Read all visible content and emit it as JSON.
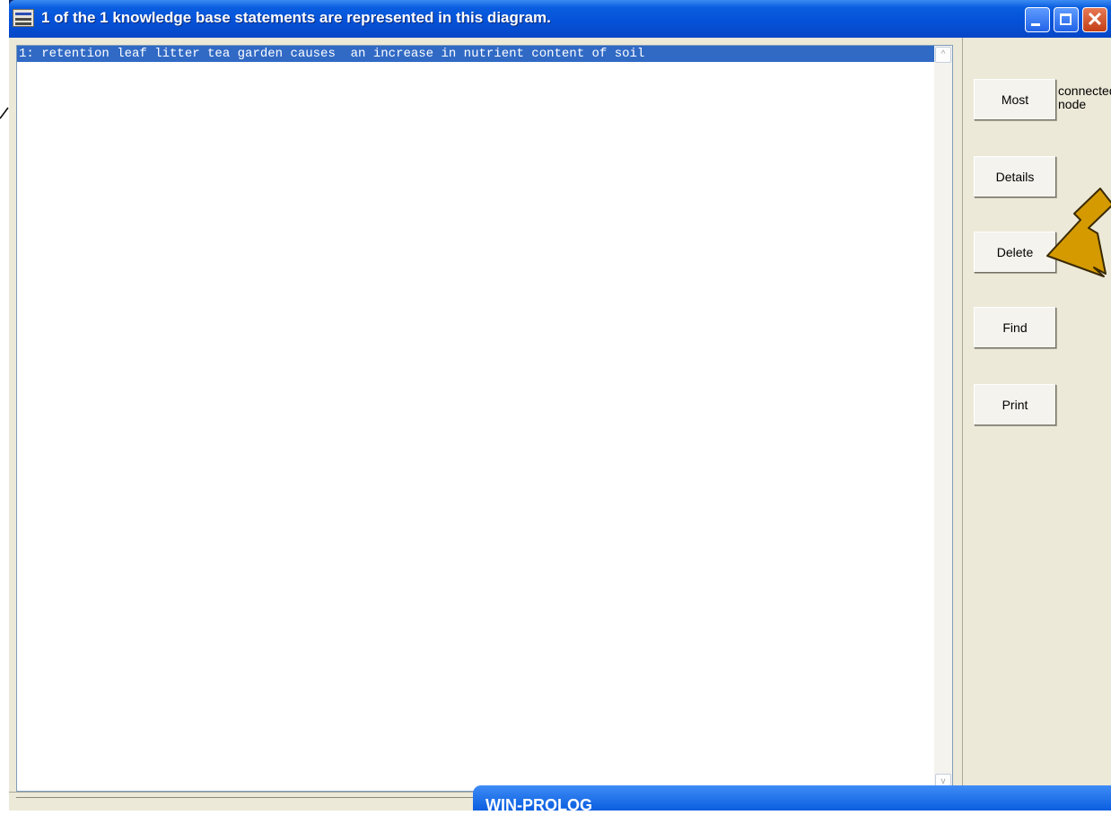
{
  "window": {
    "title": "1 of the 1 knowledge base statements are represented in this diagram.",
    "icon": "app-icon",
    "controls": [
      "minimize-icon",
      "maximize-icon",
      "close-icon"
    ]
  },
  "listbox": {
    "items": [
      "1: retention leaf litter tea garden causes  an increase in nutrient content of soil"
    ],
    "selected_index": 0,
    "scroll_up_glyph": "^",
    "scroll_down_glyph": "v"
  },
  "panel": {
    "buttons": [
      "Most",
      "Details",
      "Delete",
      "Find",
      "Print"
    ],
    "most_hint": "connected\nnode"
  },
  "taskbar_window": {
    "title": "WIN-PROLOG"
  },
  "colors": {
    "title_blue": "#0552d8",
    "selection": "#316ac5",
    "panel_bg": "#ece9d8",
    "arrow_fill": "#d49a00",
    "close_red": "#c43f17"
  }
}
